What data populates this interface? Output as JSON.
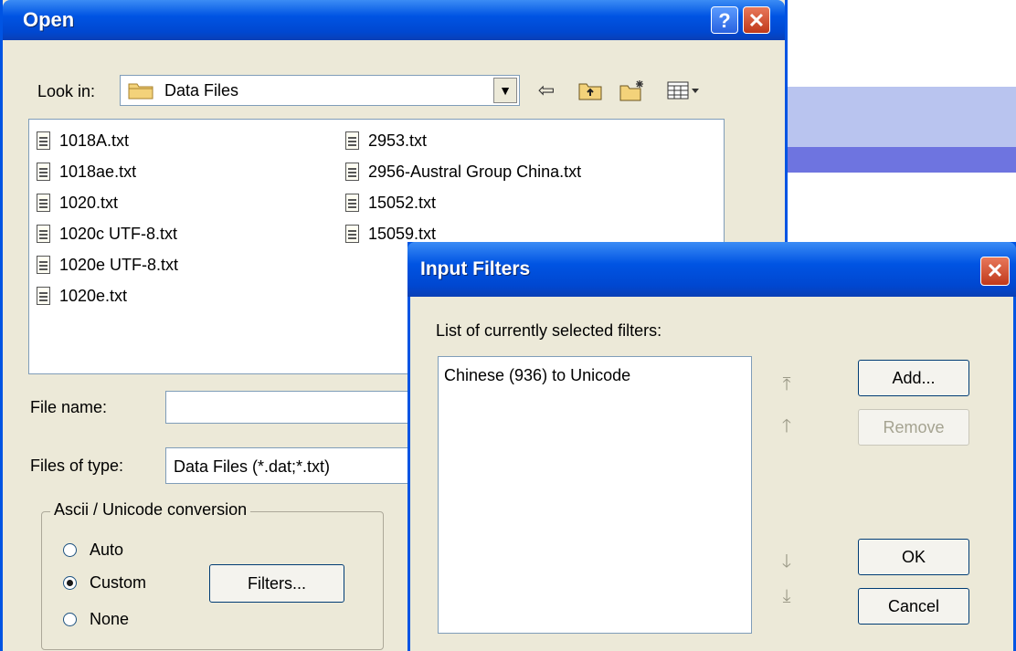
{
  "open_dialog": {
    "title": "Open",
    "help_btn": "?",
    "close_btn": "✕",
    "lookin_label": "Look in:",
    "lookin_value": "Data Files",
    "files": [
      {
        "name": "1018A.txt"
      },
      {
        "name": "1018ae.txt"
      },
      {
        "name": "1020.txt"
      },
      {
        "name": "1020c UTF-8.txt"
      },
      {
        "name": "1020e UTF-8.txt"
      },
      {
        "name": "1020e.txt"
      },
      {
        "name": "2953.txt"
      },
      {
        "name": "2956-Austral Group China.txt"
      },
      {
        "name": "15052.txt"
      },
      {
        "name": "15059.txt"
      }
    ],
    "filename_label": "File name:",
    "filename_value": "",
    "filetype_label": "Files of type:",
    "filetype_value": "Data Files (*.dat;*.txt)",
    "group_title": "Ascii / Unicode conversion",
    "radios": [
      {
        "label": "Auto",
        "checked": false
      },
      {
        "label": "Custom",
        "checked": true
      },
      {
        "label": "None",
        "checked": false
      }
    ],
    "filters_btn": "Filters..."
  },
  "filters_dialog": {
    "title": "Input Filters",
    "close_btn": "✕",
    "list_label": "List of currently selected filters:",
    "filters": [
      "Chinese (936) to Unicode"
    ],
    "add_btn": "Add...",
    "remove_btn": "Remove",
    "ok_btn": "OK",
    "cancel_btn": "Cancel"
  },
  "colors": {
    "title_blue": "#0054e3",
    "dialog_bg": "#ece9d8",
    "close_red": "#c0391b"
  }
}
